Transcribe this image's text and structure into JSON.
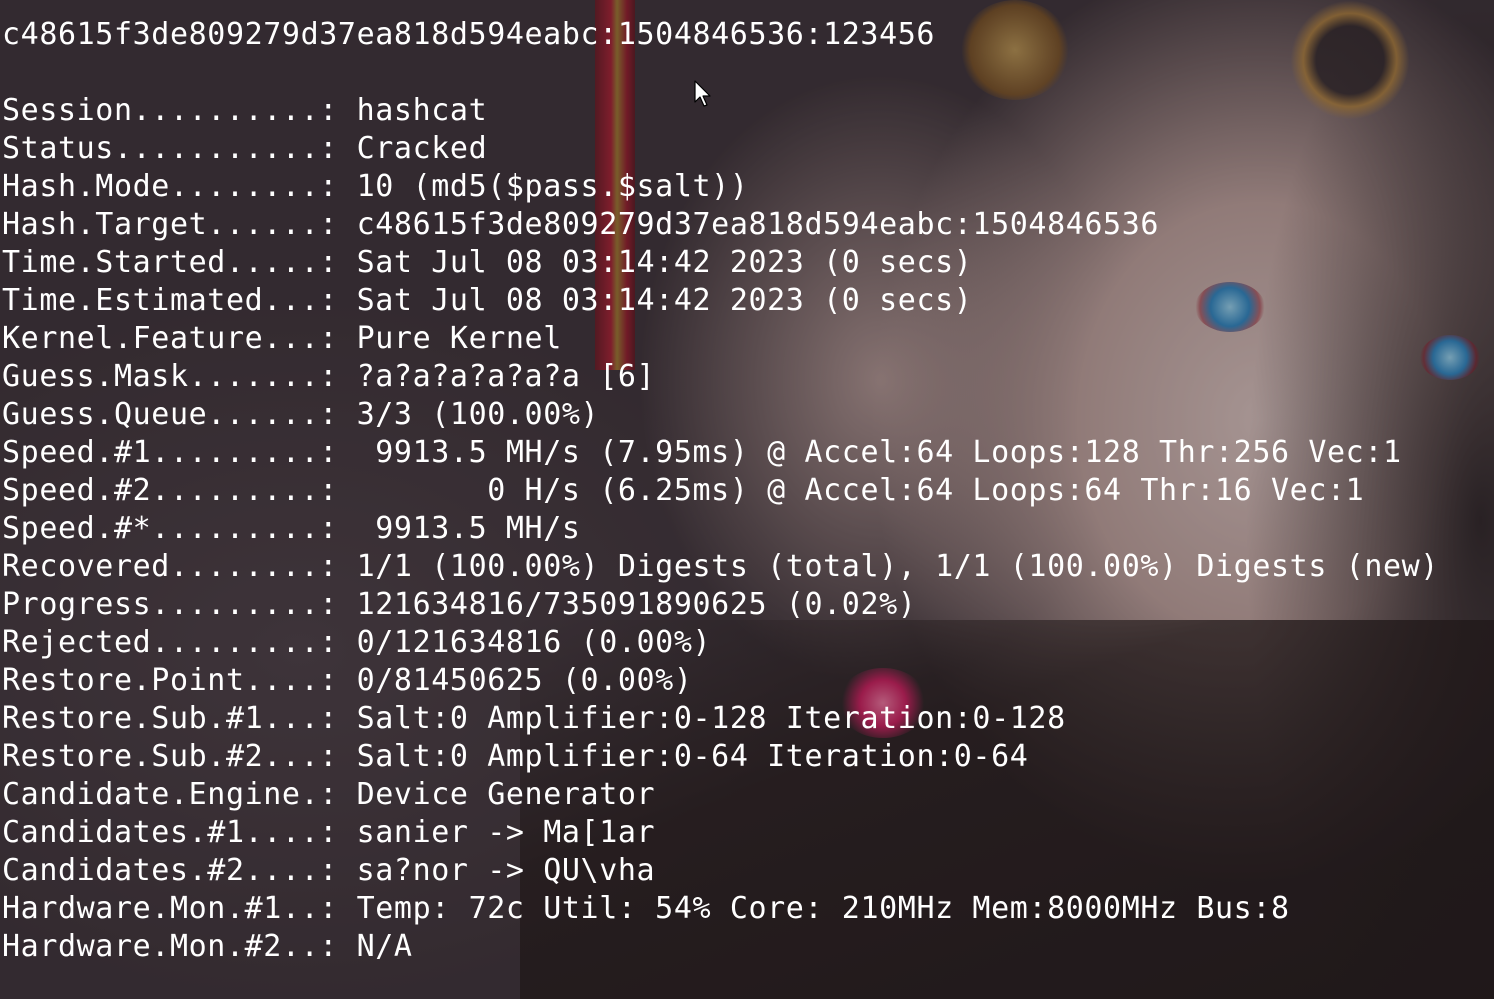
{
  "terminal": {
    "cracked_line": "c48615f3de809279d37ea818d594eabc:1504846536:123456",
    "status_lines": [
      {
        "key": "Session.........",
        "value": "hashcat"
      },
      {
        "key": "Status..........",
        "value": "Cracked"
      },
      {
        "key": "Hash.Mode.......",
        "value": "10 (md5($pass.$salt))"
      },
      {
        "key": "Hash.Target.....",
        "value": "c48615f3de809279d37ea818d594eabc:1504846536"
      },
      {
        "key": "Time.Started....",
        "value": "Sat Jul 08 03:14:42 2023 (0 secs)"
      },
      {
        "key": "Time.Estimated..",
        "value": "Sat Jul 08 03:14:42 2023 (0 secs)"
      },
      {
        "key": "Kernel.Feature..",
        "value": "Pure Kernel"
      },
      {
        "key": "Guess.Mask......",
        "value": "?a?a?a?a?a?a [6]"
      },
      {
        "key": "Guess.Queue.....",
        "value": "3/3 (100.00%)"
      },
      {
        "key": "Speed.#1........",
        "value": " 9913.5 MH/s (7.95ms) @ Accel:64 Loops:128 Thr:256 Vec:1"
      },
      {
        "key": "Speed.#2........",
        "value": "       0 H/s (6.25ms) @ Accel:64 Loops:64 Thr:16 Vec:1"
      },
      {
        "key": "Speed.#*........",
        "value": " 9913.5 MH/s"
      },
      {
        "key": "Recovered.......",
        "value": "1/1 (100.00%) Digests (total), 1/1 (100.00%) Digests (new)"
      },
      {
        "key": "Progress........",
        "value": "121634816/735091890625 (0.02%)"
      },
      {
        "key": "Rejected........",
        "value": "0/121634816 (0.00%)"
      },
      {
        "key": "Restore.Point...",
        "value": "0/81450625 (0.00%)"
      },
      {
        "key": "Restore.Sub.#1..",
        "value": "Salt:0 Amplifier:0-128 Iteration:0-128"
      },
      {
        "key": "Restore.Sub.#2..",
        "value": "Salt:0 Amplifier:0-64 Iteration:0-64"
      },
      {
        "key": "Candidate.Engine",
        "value": "Device Generator"
      },
      {
        "key": "Candidates.#1...",
        "value": "sanier -> Ma[1ar"
      },
      {
        "key": "Candidates.#2...",
        "value": "sa?nor -> QU\\vha"
      },
      {
        "key": "Hardware.Mon.#1.",
        "value": "Temp: 72c Util: 54% Core: 210MHz Mem:8000MHz Bus:8"
      },
      {
        "key": "Hardware.Mon.#2.",
        "value": "N/A"
      }
    ],
    "separator": ".: "
  },
  "colors": {
    "text": "#ffffff",
    "background": "#3d3438"
  },
  "icons": {
    "cursor": "mouse-pointer-icon"
  }
}
